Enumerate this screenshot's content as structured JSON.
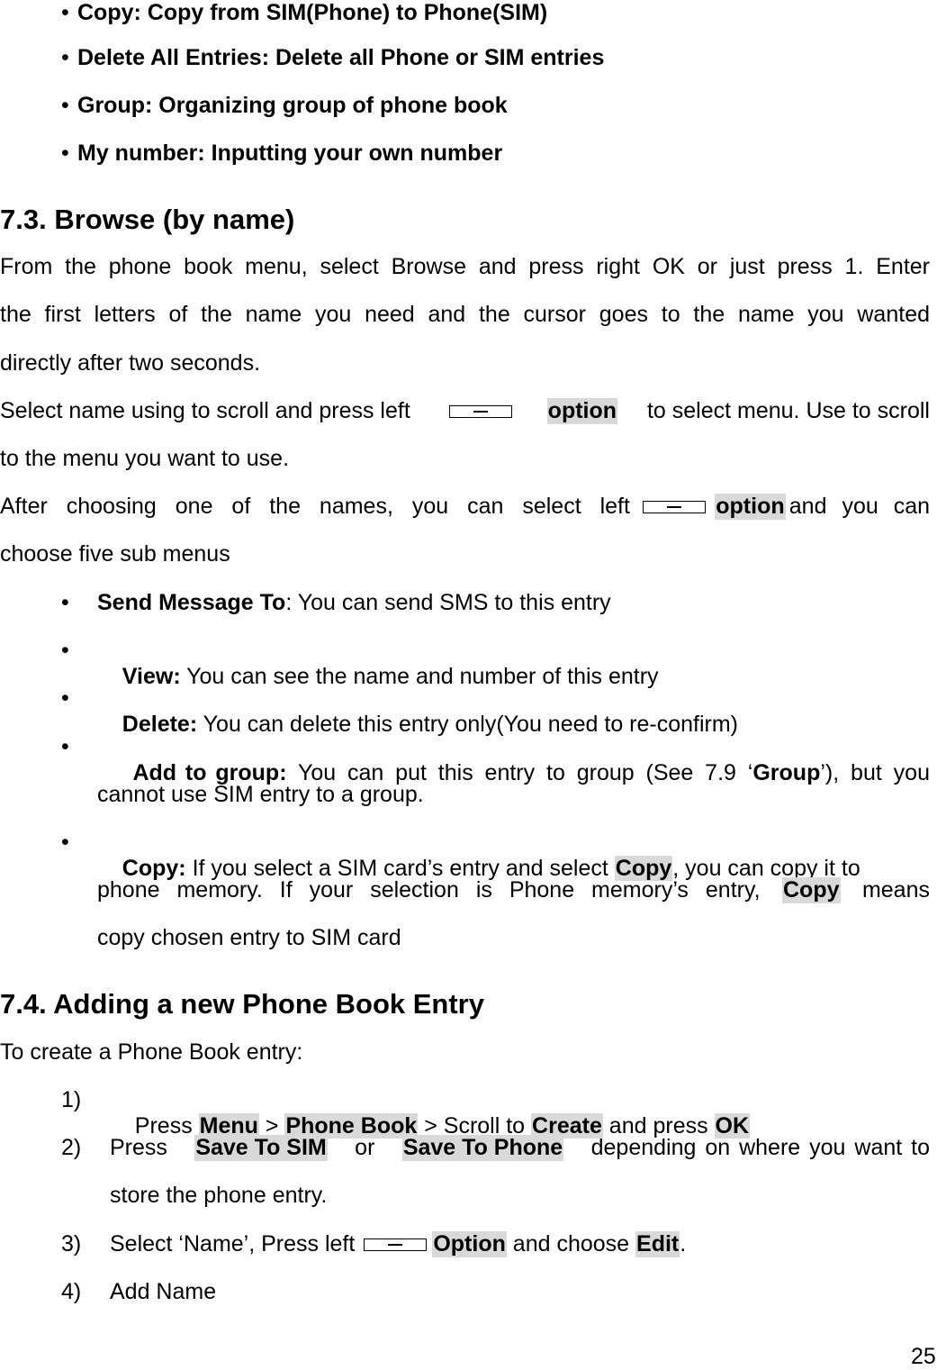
{
  "top_bullets": [
    {
      "label": "Copy: Copy from SIM(Phone) to Phone(SIM)"
    },
    {
      "label": "Delete All Entries: Delete all Phone or SIM entries"
    },
    {
      "label": "Group: Organizing group of phone book"
    },
    {
      "label": "My number: Inputting your own number"
    }
  ],
  "section_7_3": {
    "heading": "7.3. Browse (by name)",
    "para1_lines": [
      "From the phone book menu, select Browse and press right OK or just press 1. Enter",
      "the first letters of the name you need and the cursor goes to the name you wanted",
      "directly after two seconds."
    ],
    "para2": {
      "before": "Select name using to scroll and press left",
      "key": "option",
      "after": "to select menu. Use to scroll",
      "line2": "to the menu you want to use."
    },
    "para3": {
      "before": "After choosing one of the names, you can select left",
      "key": "option",
      "after": "and you can",
      "line2": "choose five sub menus"
    },
    "sub_menus": [
      {
        "term": "Send Message To",
        "text": ": You can send SMS to this entry"
      },
      {
        "term": "View:",
        "text": " You can see the name and number of this entry"
      },
      {
        "term": "Delete:",
        "text": " You can delete this entry only(You need to re-confirm)"
      },
      {
        "term": "Add to group:",
        "text": " You can put this entry to group (See 7.9 ‘",
        "ref": "Group",
        "text2": "’), but you",
        "line2": "cannot use SIM entry to a group."
      },
      {
        "term": "Copy:",
        "text": " If you select a SIM card’s entry and select ",
        "key1": "Copy",
        "text2": ", you can copy it to",
        "line2_before": "phone memory. If your selection is Phone memory’s entry,",
        "key2": "Copy",
        "line2_after": "means",
        "line3": "copy chosen entry to SIM card"
      }
    ]
  },
  "section_7_4": {
    "heading": "7.4. Adding a new Phone Book Entry",
    "intro": "To create a Phone Book entry:",
    "steps": [
      {
        "num": "1)",
        "p1": "Press ",
        "k1": "Menu",
        "p2": " > ",
        "k2": "Phone Book",
        "p3": " > Scroll to ",
        "k3": "Create",
        "p4": " and press ",
        "k4": "OK"
      },
      {
        "num": "2)",
        "p1": "Press",
        "k1": "Save To SIM",
        "p2": "or",
        "k2": "Save To Phone",
        "p3": "depending on where you want to",
        "line2": "store the phone entry."
      },
      {
        "num": "3)",
        "p1": "Select ‘Name’, Press left",
        "k1": "Option",
        "p2": " and choose ",
        "k2": "Edit",
        "p3": "."
      },
      {
        "num": "4)",
        "p1": "Add Name"
      }
    ]
  },
  "page_number": "25",
  "colors": {
    "highlight": "#d9d9d9",
    "text": "#000000"
  }
}
